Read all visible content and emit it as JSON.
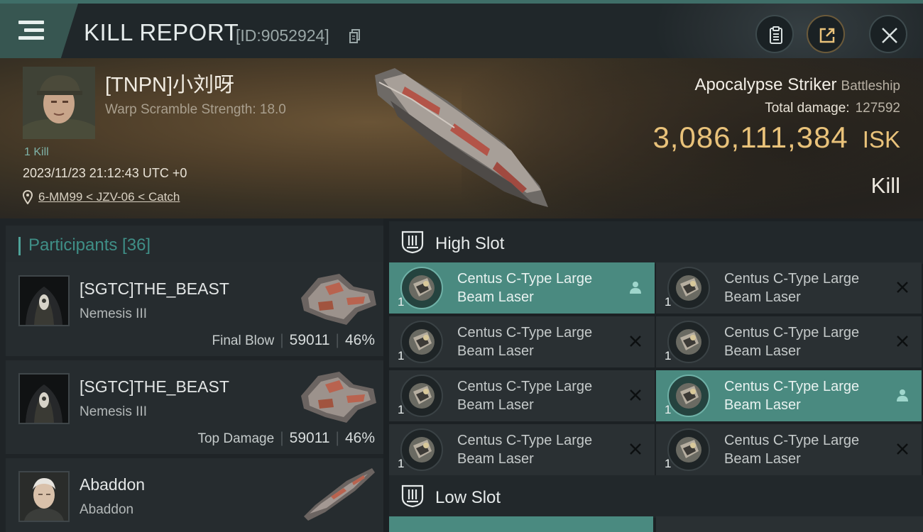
{
  "header": {
    "title": "KILL REPORT",
    "report_id": "[ID:9052924]",
    "icons": [
      "menu-icon",
      "copy-icon",
      "clipboard-icon",
      "share-icon",
      "close-icon"
    ]
  },
  "victim": {
    "name": "[TNPN]小刘呀",
    "warp_scramble": "Warp Scramble Strength: 18.0",
    "kill_count": "1 Kill",
    "datetime": "2023/11/23 21:12:43 UTC +0",
    "location": "6-MM99 < JZV-06 < Catch",
    "ship_name": "Apocalypse Striker",
    "ship_class": "Battleship",
    "total_damage_label": "Total damage:",
    "total_damage": "127592",
    "isk_value": "3,086,111,384",
    "isk_unit": "ISK",
    "result": "Kill"
  },
  "participants": {
    "title": "Participants [36]",
    "items": [
      {
        "name": "[SGTC]THE_BEAST",
        "ship": "Nemesis III",
        "role": "Final Blow",
        "damage": "59011",
        "percent": "46%"
      },
      {
        "name": "[SGTC]THE_BEAST",
        "ship": "Nemesis III",
        "role": "Top Damage",
        "damage": "59011",
        "percent": "46%"
      },
      {
        "name": "Abaddon",
        "ship": "Abaddon"
      }
    ]
  },
  "slots": {
    "high_title": "High Slot",
    "low_title": "Low Slot",
    "modules": [
      {
        "line1": "Centus C-Type Large",
        "line2": "Beam Laser",
        "qty": "1",
        "state": "fitted"
      },
      {
        "line1": "Centus C-Type Large",
        "line2": "Beam Laser",
        "qty": "1",
        "state": "destroyed"
      },
      {
        "line1": "Centus C-Type Large",
        "line2": "Beam Laser",
        "qty": "1",
        "state": "destroyed"
      },
      {
        "line1": "Centus C-Type Large",
        "line2": "Beam Laser",
        "qty": "1",
        "state": "destroyed"
      },
      {
        "line1": "Centus C-Type Large",
        "line2": "Beam Laser",
        "qty": "1",
        "state": "destroyed"
      },
      {
        "line1": "Centus C-Type Large",
        "line2": "Beam Laser",
        "qty": "1",
        "state": "fitted"
      },
      {
        "line1": "Centus C-Type Large",
        "line2": "Beam Laser",
        "qty": "1",
        "state": "destroyed"
      },
      {
        "line1": "Centus C-Type Large",
        "line2": "Beam Laser",
        "qty": "1",
        "state": "destroyed"
      }
    ]
  },
  "colors": {
    "accent_teal": "#4a8a80",
    "isk_gold": "#e9c27a",
    "panel": "#262c2f"
  }
}
